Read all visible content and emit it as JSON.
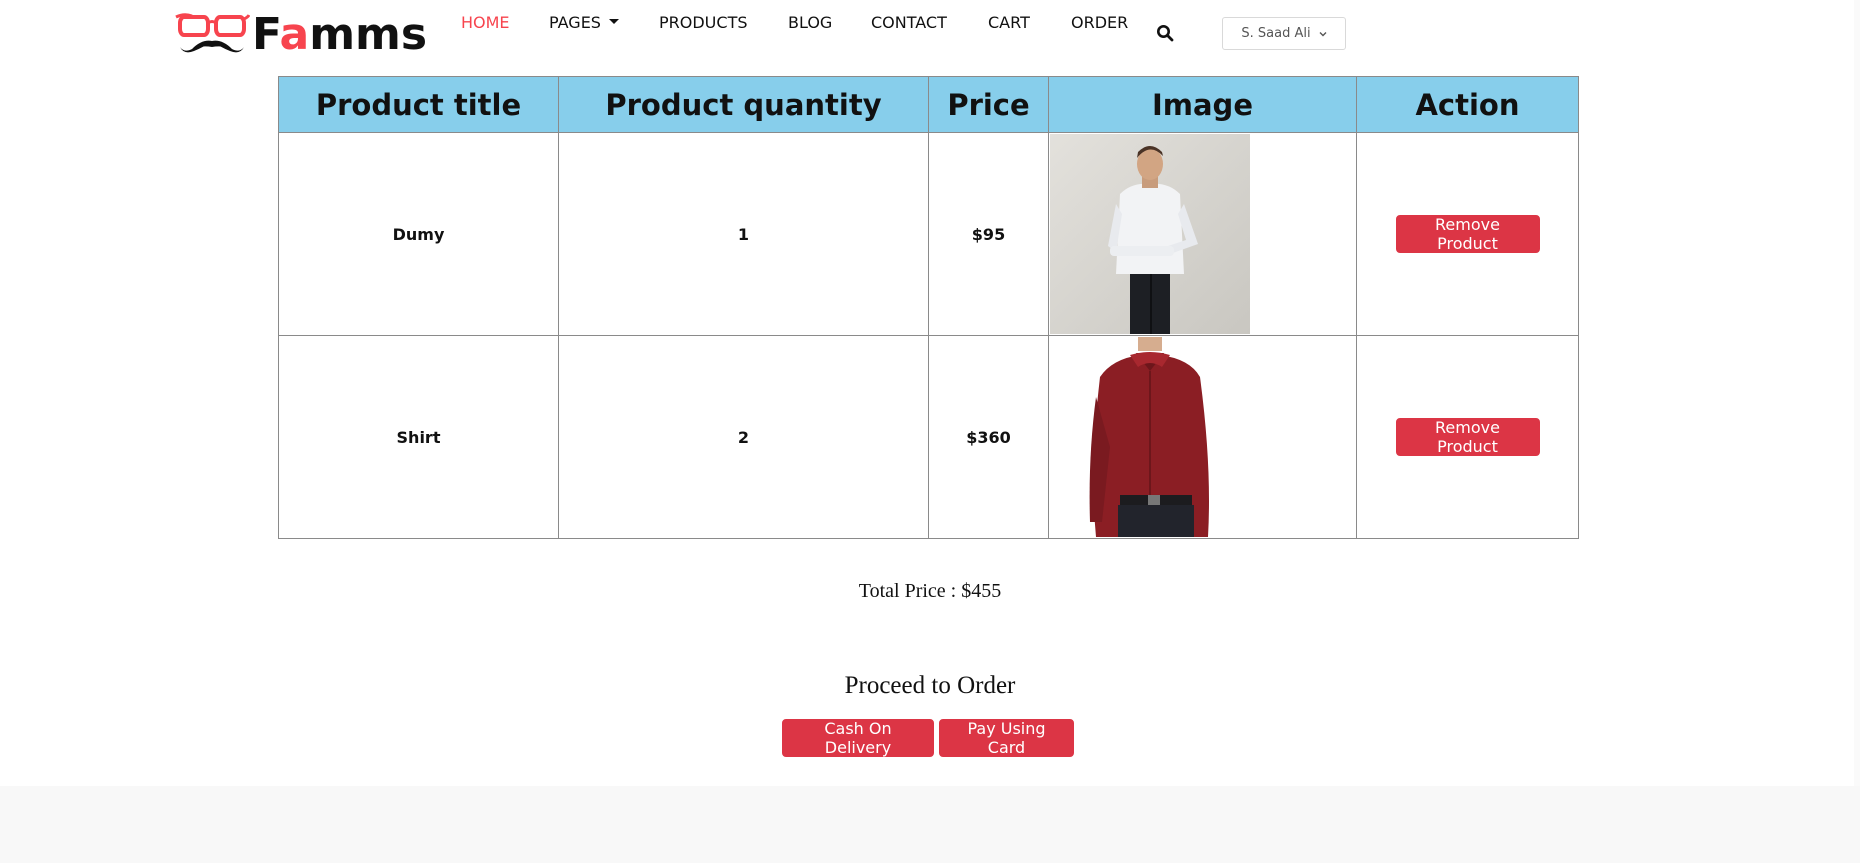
{
  "brand": {
    "name_prefix": "F",
    "name_accent": "a",
    "name_suffix": "mms"
  },
  "nav": {
    "items": [
      {
        "label": "HOME",
        "active": true
      },
      {
        "label": "PAGES",
        "has_dropdown": true
      },
      {
        "label": "PRODUCTS"
      },
      {
        "label": "BLOG"
      },
      {
        "label": "CONTACT"
      },
      {
        "label": "CART"
      },
      {
        "label": "ORDER"
      }
    ],
    "search_icon": "search-icon",
    "user_menu_label": "S. Saad Ali"
  },
  "table": {
    "headers": [
      "Product title",
      "Product quantity",
      "Price",
      "Image",
      "Action"
    ],
    "rows": [
      {
        "title": "Dumy",
        "quantity": "1",
        "price": "$95",
        "image": "man-white-shirt-photo",
        "action": "Remove Product"
      },
      {
        "title": "Shirt",
        "quantity": "2",
        "price": "$360",
        "image": "man-red-shirt-photo",
        "action": "Remove Product"
      }
    ]
  },
  "total": {
    "text": "Total Price : $455"
  },
  "order": {
    "heading": "Proceed to Order",
    "cash_on_delivery": "Cash On Delivery",
    "pay_using_card": "Pay Using Card"
  },
  "colors": {
    "accent": "#f7444e",
    "table_header_bg": "#87ceeb",
    "button_red": "#dc3545",
    "footer_bg": "#f8f8f8"
  }
}
